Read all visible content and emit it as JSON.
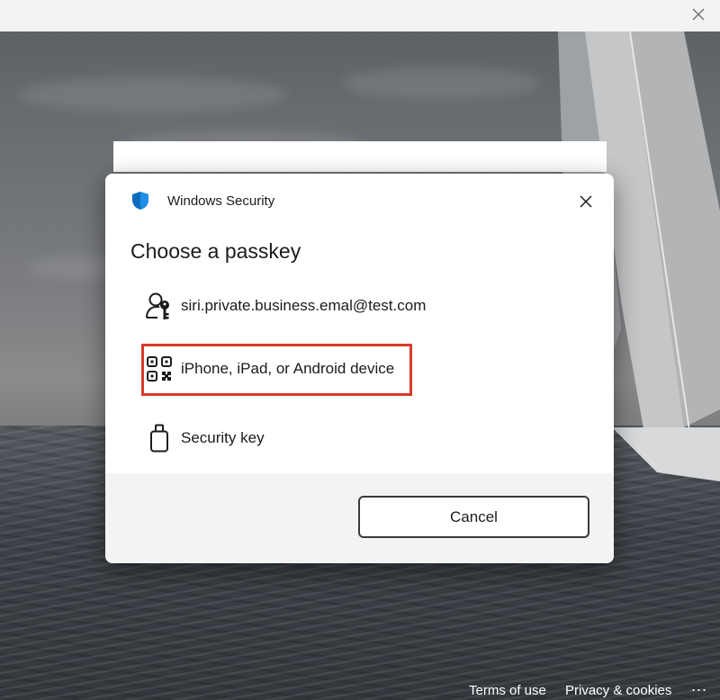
{
  "window": {
    "close_icon": "close-icon"
  },
  "dialog": {
    "app_name": "Windows Security",
    "heading": "Choose a passkey",
    "options": [
      {
        "label": "siri.private.business.emal@test.com",
        "icon": "user-key-icon"
      },
      {
        "label": "iPhone, iPad, or Android device",
        "icon": "qr-code-icon",
        "highlighted": true
      },
      {
        "label": "Security key",
        "icon": "usb-key-icon"
      }
    ],
    "cancel_label": "Cancel"
  },
  "footer_links": {
    "terms": "Terms of use",
    "privacy": "Privacy & cookies",
    "more": "..."
  },
  "colors": {
    "highlight_border": "#d83b2a",
    "shield_blue": "#0f6cbd",
    "dialog_footer": "#f3f3f3"
  }
}
